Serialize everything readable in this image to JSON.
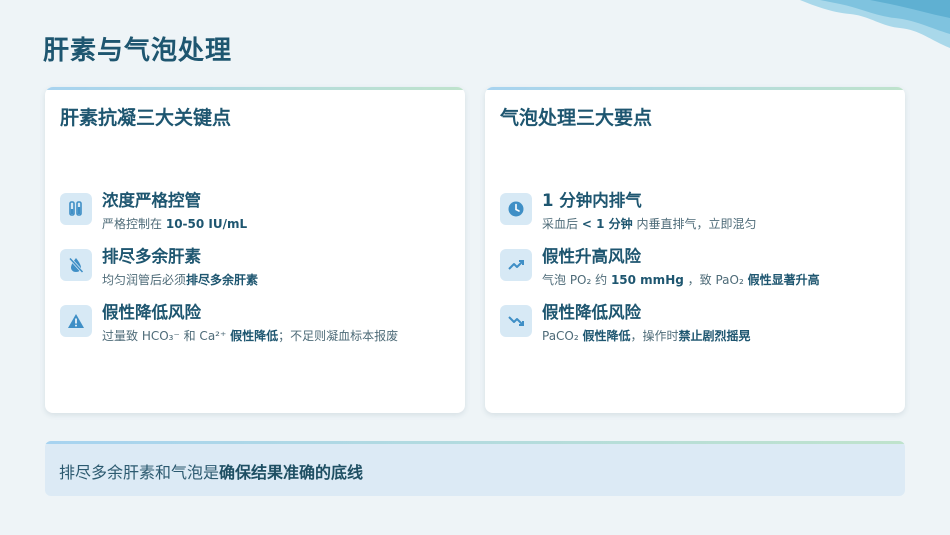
{
  "page": {
    "title": "肝素与气泡处理"
  },
  "left_card": {
    "title": "肝素抗凝三大关键点",
    "items": [
      {
        "icon": "flask-icon",
        "title": "浓度严格控管",
        "desc_pre": "严格控制在",
        "desc_bold": "10-50 IU/mL",
        "desc_post": ""
      },
      {
        "icon": "no-drop-icon",
        "title": "排尽多余肝素",
        "desc_pre": "均匀润管后必须",
        "desc_bold": "排尽多余肝素",
        "desc_post": ""
      },
      {
        "icon": "warning-icon",
        "title": "假性降低风险",
        "desc_pre": "过量致 HCO₃⁻ 和 Ca²⁺",
        "desc_bold": "假性降低",
        "desc_post": "；不足则凝血标本报废"
      }
    ]
  },
  "right_card": {
    "title": "气泡处理三大要点",
    "items": [
      {
        "icon": "clock-icon",
        "title": "1 分钟内排气",
        "desc_pre": "采血后",
        "desc_bold": "< 1 分钟",
        "desc_post": "内垂直排气，立即混匀"
      },
      {
        "icon": "trend-up-icon",
        "title": "假性升高风险",
        "desc_pre": "气泡 PO₂ 约",
        "desc_bold": "150 mmHg",
        "desc_post": "，致 PaO₂",
        "desc_bold2": "假性显著升高"
      },
      {
        "icon": "trend-down-icon",
        "title": "假性降低风险",
        "desc_pre": "PaCO₂",
        "desc_bold": "假性降低",
        "desc_post": "，操作时",
        "desc_bold2": "禁止剧烈摇晃"
      }
    ]
  },
  "summary": {
    "text_pre": "排尽多余肝素和气泡是",
    "text_bold": "确保结果准确的底线"
  },
  "colors": {
    "accent": "#1e5670",
    "icon_bg": "#d7e9f5",
    "icon_fg": "#3f8fc6",
    "summary_bg": "#dceaf5"
  }
}
